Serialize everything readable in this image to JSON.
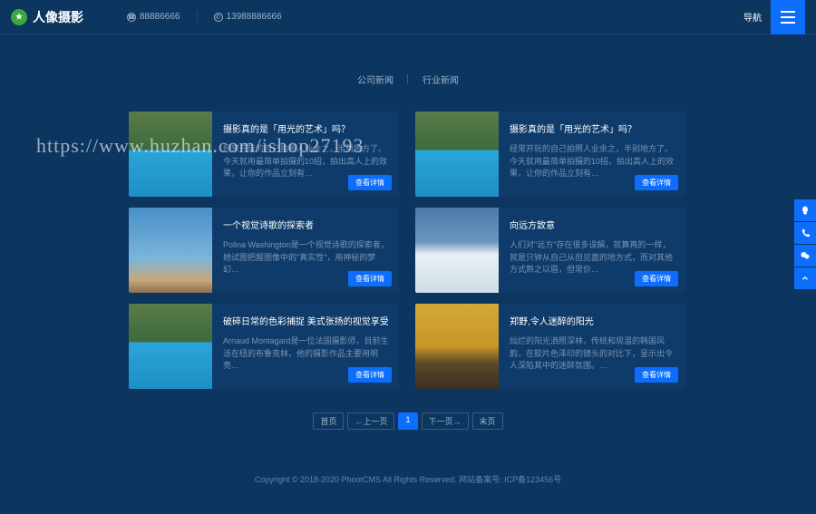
{
  "header": {
    "logo_text": "人像摄影",
    "phone1": "88886666",
    "phone2": "13988886666",
    "nav_label": "导航"
  },
  "watermark": "https://www.huzhan.com/ishop27193",
  "tabs": [
    "公司新闻",
    "行业新闻"
  ],
  "side_icons": [
    "qq-icon",
    "phone-icon",
    "wechat-icon",
    "arrow-up-icon"
  ],
  "cards": [
    {
      "title": "摄影真的是「用光的艺术」吗？",
      "desc": "经常开玩的自己拍照人业余之，半别地方了。今天就用最简单拍摄的10招，拍出高人上的效果，让你的作品立刻有…",
      "btn": "查看详情",
      "thumb": "thumb-pool"
    },
    {
      "title": "摄影真的是「用光的艺术」吗？",
      "desc": "经常开玩的自己拍照人业余之，半别地方了。今天就用最简单拍摄的10招，拍出高人上的效果，让你的作品立刻有…",
      "btn": "查看详情",
      "thumb": "thumb-pool"
    },
    {
      "title": "一个视觉诗歌的探索者",
      "desc": "Polina Washington是一个视觉诗歌的探索者，她试图把握图像中的\"真实性\"，用神秘的梦幻…",
      "btn": "查看详情",
      "thumb": "thumb-sky"
    },
    {
      "title": "向远方致意",
      "desc": "人们对\"远方\"存在很多误解，就算再的一样，就是只钟从自己从但见面的地方式，而对其他方式熟之以眉，但常价…",
      "btn": "查看详情",
      "thumb": "thumb-snow"
    },
    {
      "title": "破碎日常的色彩捕捉 美式张扬的视觉享受",
      "desc": "Arnaud Montagard是一位法国摄影师，目前生活在纽的布鲁克林，他的摄影作品主要用明亮…",
      "btn": "查看详情",
      "thumb": "thumb-pool"
    },
    {
      "title": "郑野,令人迷醉的阳光",
      "desc": "灿烂的阳光洒照深林，传统和现温的韩国风韵，在胶片色泽印的镜头的对比下，呈示出令人深陷其中的迷醉氛围。…",
      "btn": "查看详情",
      "thumb": "thumb-autumn"
    }
  ],
  "pagination": {
    "first": "首页",
    "prev": "←上一页",
    "current": "1",
    "next": "下一页→",
    "last": "末页"
  },
  "footer": "Copyright © 2018-2020 PbootCMS All Rights Reserved. 网站备案号: ICP备123456号"
}
